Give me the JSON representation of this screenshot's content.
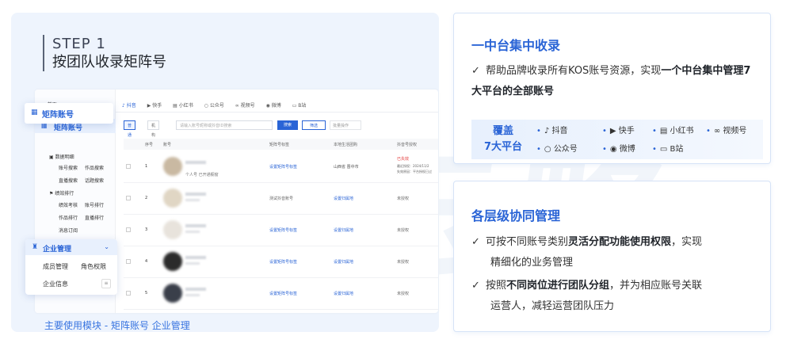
{
  "watermark": "云略",
  "left": {
    "step_line1": "STEP 1",
    "step_line2": "按团队收录矩阵号",
    "caption": "主要使用模块 - 矩阵账号 企业管理",
    "app": {
      "sidebar": {
        "home": "首页",
        "matrix_account": "矩阵账号",
        "data_reports": "数据明细",
        "account_search": "账号搜索",
        "works_search": "作品搜索",
        "live_search": "直播搜索",
        "topic_search": "话题搜索",
        "performance": "绩效排行",
        "performance_assess": "绩效考核",
        "account_rank": "账号排行",
        "works_rank": "作品排行",
        "live_rank": "直播排行",
        "msg_sub": "消息订阅"
      },
      "tabs": [
        "抖音",
        "快手",
        "小红书",
        "公众号",
        "视频号",
        "微博",
        "B站"
      ],
      "filters": {
        "chip1": "普通号",
        "chip2": "机构号",
        "search_placeholder": "请输入账号昵称或抖音ID搜索",
        "search_btn": "搜索",
        "filter_btn": "筛选",
        "batch_btn": "批量操作"
      },
      "table_headers": [
        "序号",
        "账号",
        "矩阵号标签",
        "本地生活团购",
        "抖音号授权"
      ],
      "rows": [
        {
          "num": "1",
          "sub": "个人号 已开通橱窗",
          "tag": "设置矩阵号标签",
          "loc": "山西省 晋中市",
          "auth": "已失效",
          "auth_note1": "最近授权：2024/11/2",
          "auth_note2": "失效原因：平台授权已过"
        },
        {
          "num": "2",
          "tag": "测试抖音账号",
          "loc": "设置归属地",
          "auth": "未授权"
        },
        {
          "num": "3",
          "tag": "设置矩阵号标签",
          "loc": "设置归属地",
          "auth": "未授权"
        },
        {
          "num": "4",
          "tag": "设置矩阵号标签",
          "loc": "设置归属地",
          "auth": "未授权"
        },
        {
          "num": "5",
          "tag": "设置矩阵号标签",
          "loc": "设置归属地",
          "auth": "未授权"
        }
      ],
      "enterprise": {
        "title": "企业管理",
        "member": "成员管理",
        "role": "角色权限",
        "info": "企业信息"
      }
    }
  },
  "card1": {
    "title": "一中台集中收录",
    "text_pre": "帮助品牌收录所有KOS账号资源，实现",
    "text_bold": "一个中台集中管理7大平台的全部账号",
    "label_line1": "覆盖",
    "label_line2": "7大平台",
    "platforms": [
      "抖音",
      "快手",
      "小红书",
      "视频号",
      "公众号",
      "微博",
      "B站"
    ]
  },
  "card2": {
    "title": "各层级协同管理",
    "item1_pre": "可按不同账号类别",
    "item1_bold": "灵活分配功能使用权限",
    "item1_post": "，实现",
    "item1_line2": "精细化的业务管理",
    "item2_pre": "按照",
    "item2_bold": "不同岗位进行团队分组",
    "item2_post": "，并为相应账号关联",
    "item2_line2": "运营人，减轻运营团队压力"
  }
}
